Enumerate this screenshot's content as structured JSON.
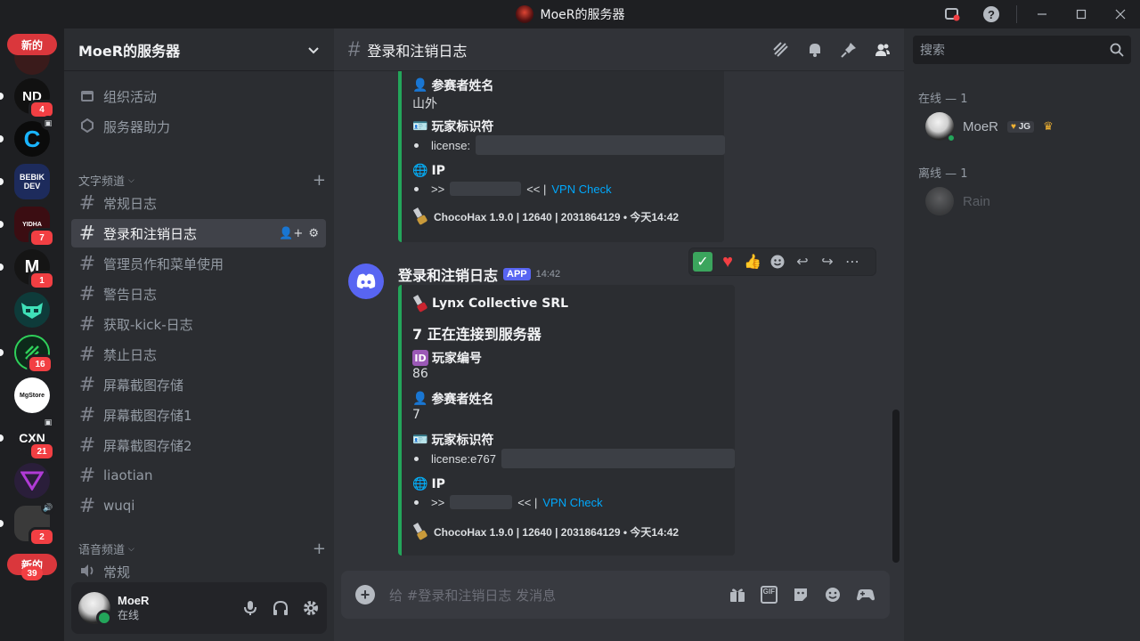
{
  "titlebar": {
    "title": "MoeR的服务器"
  },
  "rail": {
    "new_top": "新的",
    "new_bottom": "新的",
    "servers": [
      {
        "label": "ND",
        "badge": "4"
      },
      {
        "label": "C",
        "badge": ""
      },
      {
        "label": "BEBIK DEV",
        "badge": ""
      },
      {
        "label": "YIDHA",
        "badge": "7"
      },
      {
        "label": "M",
        "badge": "1"
      },
      {
        "label": "raccoon",
        "badge": ""
      },
      {
        "label": "rocket",
        "badge": "16"
      },
      {
        "label": "MgStore",
        "badge": ""
      },
      {
        "label": "CXN",
        "badge": "21"
      },
      {
        "label": "V",
        "badge": ""
      },
      {
        "label": "photo",
        "badge": "2"
      }
    ],
    "bottom_badge": "39"
  },
  "sidebar": {
    "server_name": "MoeR的服务器",
    "events": "组织活动",
    "boost": "服务器助力",
    "text_category": "文字频道",
    "voice_category": "语音频道",
    "channels": [
      "常规日志",
      "登录和注销日志",
      "管理员作和菜单使用",
      "警告日志",
      "获取-kick-日志",
      "禁止日志",
      "屏幕截图存储",
      "屏幕截图存储1",
      "屏幕截图存储2",
      "liaotian",
      "wuqi"
    ],
    "voice_channels": [
      "常规"
    ]
  },
  "user": {
    "name": "MoeR",
    "status": "在线"
  },
  "channel": {
    "name": "登录和注销日志",
    "composer_placeholder": "给 #登录和注销日志 发消息"
  },
  "embed1": {
    "f1_title": "参赛者姓名",
    "f1_value": "山外",
    "f2_title": "玩家标识符",
    "f2_license": "license:",
    "f3_title": "IP",
    "ip_prefix": ">>",
    "ip_suffix": "<< |",
    "vpn": "VPN Check",
    "footer": "ChocoHax 1.9.0 | 12640 | 2031864129 • 今天14:42"
  },
  "message": {
    "author": "登录和注销日志",
    "app_tag": "APP",
    "time": "14:42"
  },
  "embed2": {
    "author": "Lynx Collective SRL",
    "title": "7 正在连接到服务器",
    "id_title": "玩家编号",
    "id_value": "86",
    "name_title": "参赛者姓名",
    "name_value": "7",
    "ident_title": "玩家标识符",
    "license": "license:e767",
    "ip_title": "IP",
    "ip_prefix": ">>",
    "ip_suffix": "<< |",
    "vpn": "VPN Check",
    "footer": "ChocoHax 1.9.0 | 12640 | 2031864129 • 今天14:42"
  },
  "members": {
    "search_placeholder": "搜索",
    "online_header": "在线 — 1",
    "offline_header": "离线 — 1",
    "online": [
      {
        "name": "MoeR",
        "tag": "JG"
      }
    ],
    "offline": [
      {
        "name": "Rain"
      }
    ]
  },
  "colors": {
    "accent": "#5865f2",
    "online": "#23a55a",
    "embed_bar": "#23a55a",
    "link": "#00a8fc",
    "badge": "#f23f43"
  }
}
